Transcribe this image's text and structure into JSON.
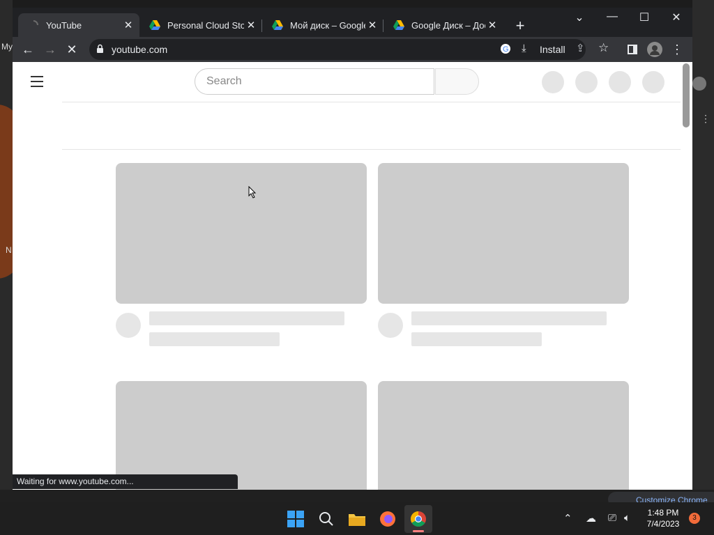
{
  "desktop": {
    "left_label_1": "My",
    "left_label_2": "N",
    "right_chip": "Customize Chrome"
  },
  "tabs": [
    {
      "title": "YouTube",
      "icon": "youtube-loading-icon",
      "active": true
    },
    {
      "title": "Personal Cloud Stora",
      "icon": "google-drive-icon",
      "active": false
    },
    {
      "title": "Мой диск – Google ,",
      "icon": "google-drive-icon",
      "active": false
    },
    {
      "title": "Google Диск – Досту",
      "icon": "google-drive-icon",
      "active": false
    }
  ],
  "toolbar": {
    "url": "youtube.com",
    "install_label": "Install"
  },
  "page": {
    "search_placeholder": "Search",
    "status_text": "Waiting for www.youtube.com..."
  },
  "taskbar": {
    "time": "1:48 PM",
    "date": "7/4/2023",
    "notification_count": "3"
  },
  "colors": {
    "tabstrip": "#202124",
    "toolbar": "#35363a",
    "skeleton_thumb": "#cccccc",
    "skeleton_line": "#e6e6e6",
    "notification_badge": "#f26b3a"
  }
}
